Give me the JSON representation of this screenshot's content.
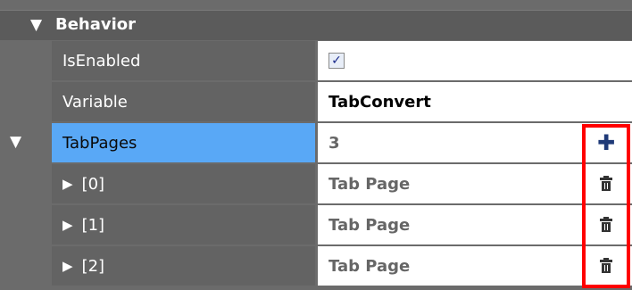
{
  "section": {
    "title": "Behavior",
    "toggle_glyph": "▼"
  },
  "rows": [
    {
      "label": "IsEnabled",
      "value_type": "checkbox",
      "checked": true,
      "check_glyph": "✓"
    },
    {
      "label": "Variable",
      "value": "TabConvert"
    },
    {
      "label": "TabPages",
      "value": "3",
      "expanded_glyph": "▼",
      "action_icon": "plus-icon",
      "action_glyph": "✚"
    },
    {
      "label": "[0]",
      "value": "Tab Page",
      "collapsed_glyph": "▶",
      "action_icon": "trash-icon"
    },
    {
      "label": "[1]",
      "value": "Tab Page",
      "collapsed_glyph": "▶",
      "action_icon": "trash-icon"
    },
    {
      "label": "[2]",
      "value": "Tab Page",
      "collapsed_glyph": "▶",
      "action_icon": "trash-icon"
    }
  ],
  "colors": {
    "panel_bg": "#6b6b6b",
    "label_bg": "#636363",
    "selected_label_bg": "#59a8f6",
    "value_bg": "#ffffff",
    "highlight_border": "#ff0000",
    "plus_icon": "#1f3a78"
  }
}
